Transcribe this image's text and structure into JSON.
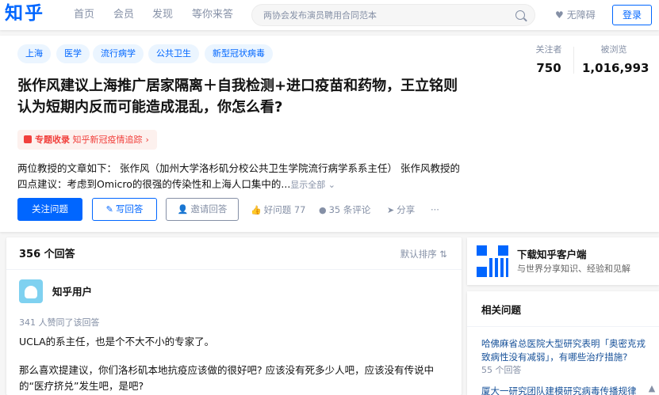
{
  "nav": {
    "logo": "知乎",
    "items": [
      "首页",
      "会员",
      "发现",
      "等你来答"
    ],
    "search_placeholder": "两协会发布演员聘用合同范本",
    "accessibility": "无障碍",
    "login": "登录"
  },
  "question": {
    "tags": [
      "上海",
      "医学",
      "流行病学",
      "公共卫生",
      "新型冠状病毒"
    ],
    "followers_label": "关注者",
    "followers_value": "750",
    "views_label": "被浏览",
    "views_value": "1,016,993",
    "title": "张作风建议上海推广居家隔离＋自我检测+进口疫苗和药物，王立铭则认为短期内反而可能造成混乱，你怎么看?",
    "collection_label": "专题收录",
    "collection_name": "知乎新冠疫情追踪",
    "excerpt": "两位教授的文章如下：  张作风（加州大学洛杉矶分校公共卫生学院流行病学系系主任） 张作风教授的四点建议：考虑到Omicro的很强的传染性和上海人口集中的...",
    "show_all": "显示全部",
    "follow_button": "关注问题",
    "write_button": "写回答",
    "invite_button": "邀请回答",
    "good_question": "好问题 77",
    "comments": "35 条评论",
    "share": "分享",
    "more": "···"
  },
  "answers": {
    "count": "356 个回答",
    "sort": "默认排序",
    "first": {
      "author": "知乎用户",
      "upvote_note": "341 人赞同了该回答",
      "p1": "UCLA的系主任，也是个不大不小的专家了。",
      "p2": "那么喜欢提建议，你们洛杉矶本地抗疫应该做的很好吧? 应该没有死多少人吧，应该没有传说中的“医疗挤兑”发生吧，是吧?"
    }
  },
  "sidebar": {
    "download_title": "下载知乎客户端",
    "download_sub": "与世界分享知识、经验和见解",
    "related_title": "相关问题",
    "related": [
      {
        "title": "哈佛麻省总医院大型研究表明「奥密克戎致病性没有减弱」，有哪些治疗措施?",
        "count": "55 个回答"
      },
      {
        "title": "厦大一研究团队建模研究病毒传播规律"
      }
    ]
  }
}
